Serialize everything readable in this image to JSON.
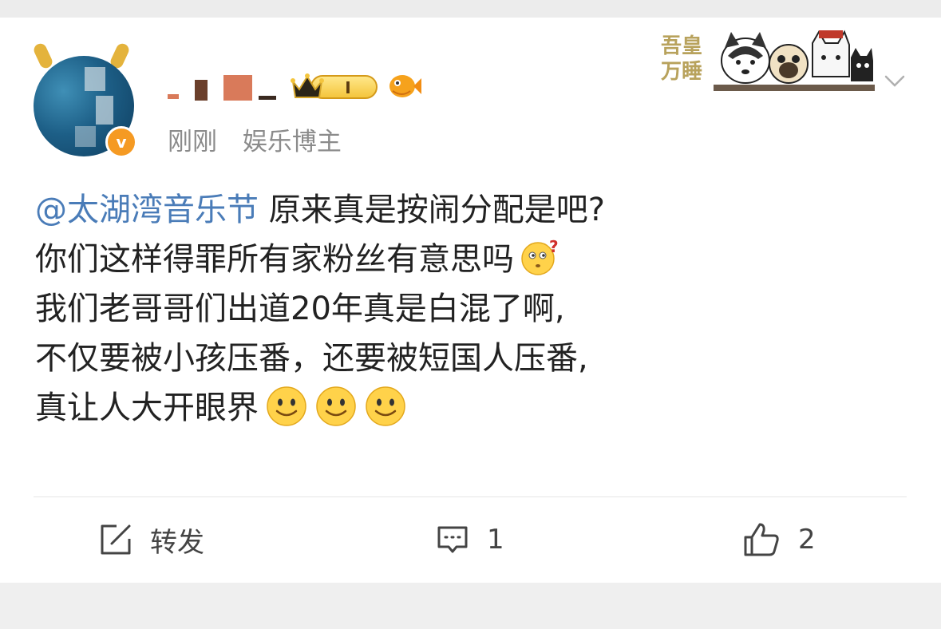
{
  "header": {
    "time": "刚刚",
    "role": "娱乐博主",
    "vip_level": "I",
    "verify_mark": "v"
  },
  "decoration": {
    "text": "吾皇万睡"
  },
  "post": {
    "mention": "@太湖湾音乐节",
    "line1_rest": " 原来真是按闹分配是吧?",
    "line2": "你们这样得罪所有家粉丝有意思吗",
    "line3": "我们老哥哥们出道20年真是白混了啊,",
    "line4": "不仅要被小孩压番，还要被短国人压番,",
    "line5": "真让人大开眼界",
    "emoji_line2": "confused-emoji",
    "emoji_line5": [
      "smile-emoji",
      "smile-emoji",
      "smile-emoji"
    ]
  },
  "actions": {
    "repost_label": "转发",
    "comment_count": "1",
    "like_count": "2"
  },
  "colors": {
    "mention": "#4a7cb8",
    "meta_text": "#8b8b8b",
    "body_text": "#222222"
  }
}
